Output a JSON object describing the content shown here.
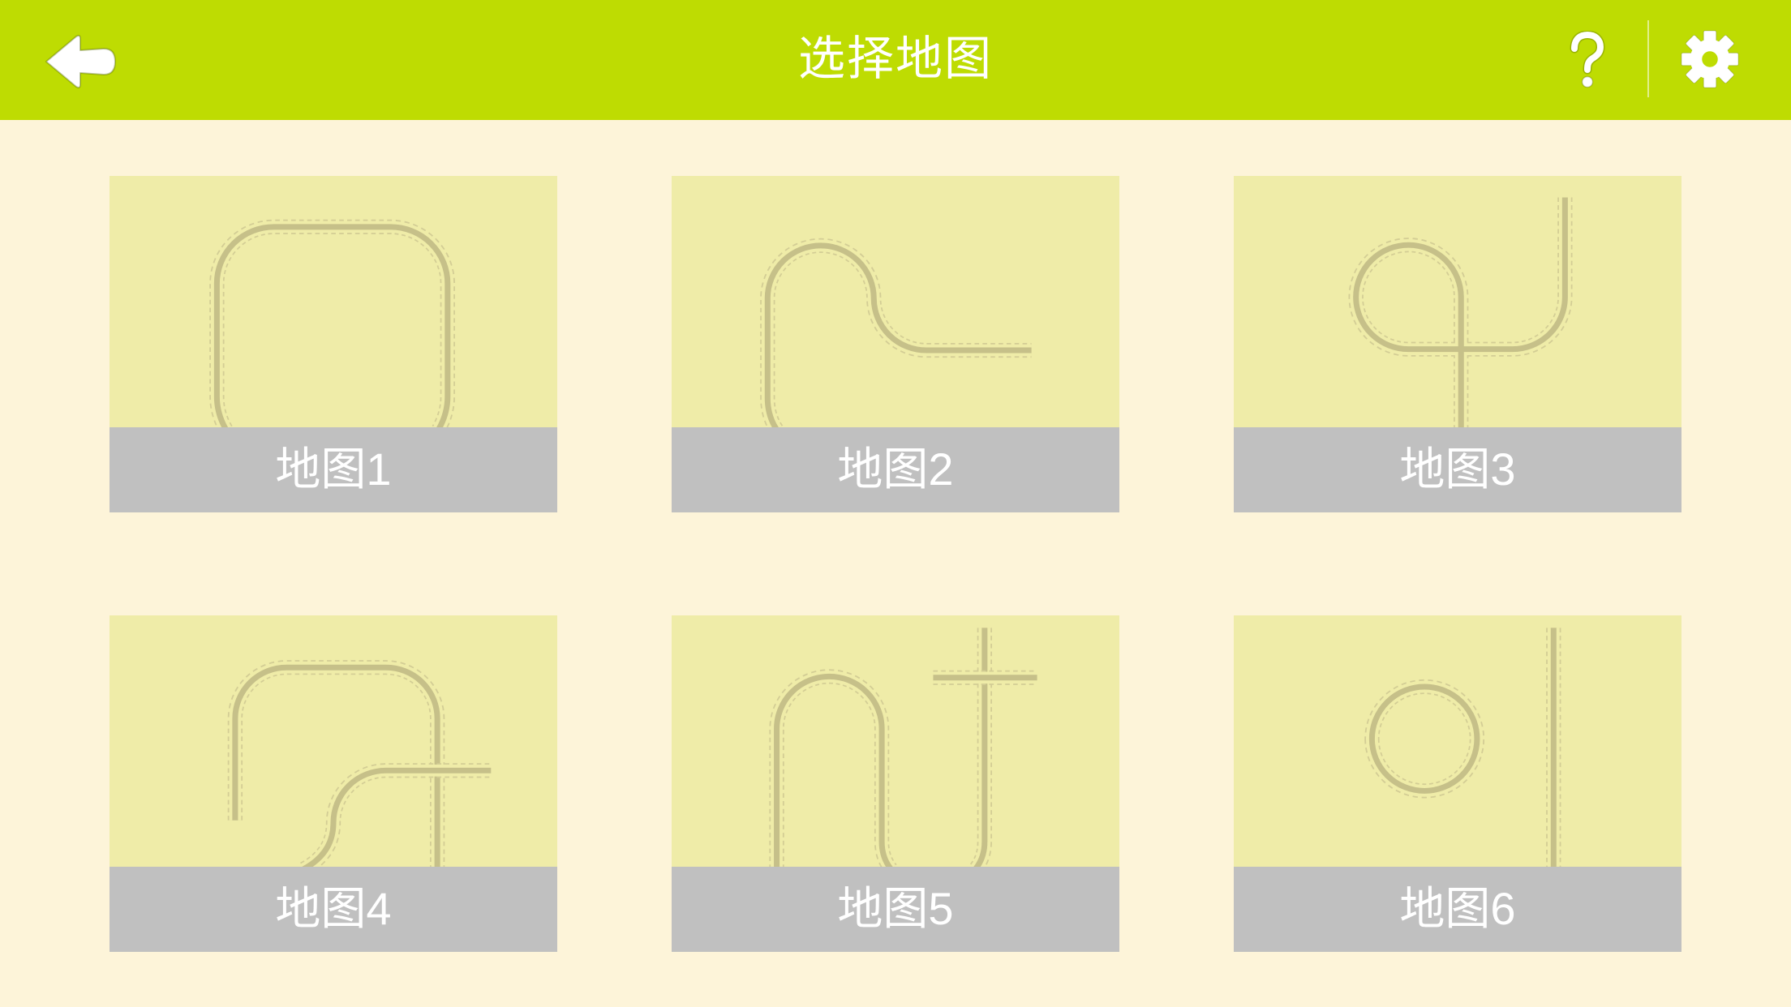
{
  "header": {
    "title": "选择地图"
  },
  "icons": {
    "back": "back-arrow-icon",
    "help": "help-icon",
    "settings": "gear-icon"
  },
  "colors": {
    "header": "#bedc02",
    "background": "#fdf4d9",
    "thumbnail": "#efeca8",
    "label": "#c0c0c0",
    "track": "#c6c089"
  },
  "maps": [
    {
      "label": "地图1"
    },
    {
      "label": "地图2"
    },
    {
      "label": "地图3"
    },
    {
      "label": "地图4"
    },
    {
      "label": "地图5"
    },
    {
      "label": "地图6"
    }
  ]
}
